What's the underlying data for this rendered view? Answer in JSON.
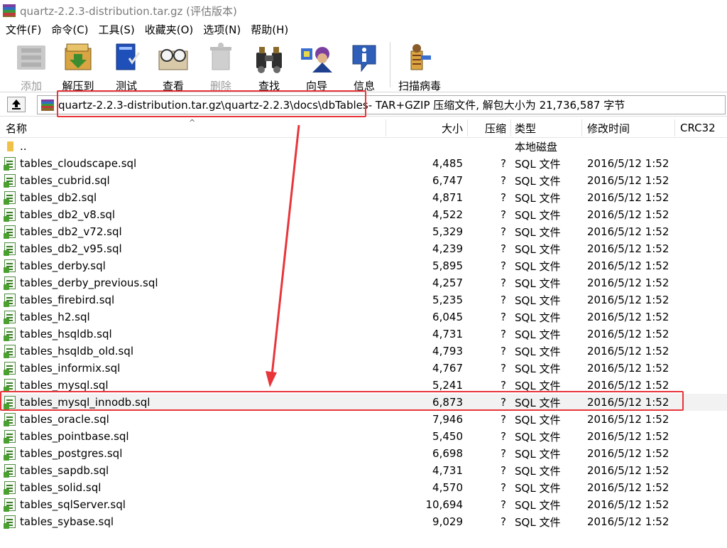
{
  "window": {
    "title": "quartz-2.2.3-distribution.tar.gz (评估版本)"
  },
  "menu": [
    {
      "label": "文件(F)"
    },
    {
      "label": "命令(C)"
    },
    {
      "label": "工具(S)"
    },
    {
      "label": "收藏夹(O)"
    },
    {
      "label": "选项(N)"
    },
    {
      "label": "帮助(H)"
    }
  ],
  "toolbar": {
    "buttons": [
      {
        "label": "添加",
        "icon": "add-icon",
        "enabled": false
      },
      {
        "label": "解压到",
        "icon": "extract-to-icon",
        "enabled": true
      },
      {
        "label": "测试",
        "icon": "test-icon",
        "enabled": true
      },
      {
        "label": "查看",
        "icon": "view-icon",
        "enabled": true
      },
      {
        "label": "删除",
        "icon": "delete-icon",
        "enabled": false
      },
      {
        "label": "查找",
        "icon": "find-icon",
        "enabled": true
      },
      {
        "label": "向导",
        "icon": "wizard-icon",
        "enabled": true
      },
      {
        "label": "信息",
        "icon": "info-icon",
        "enabled": true
      },
      {
        "label": "扫描病毒",
        "icon": "virus-scan-icon",
        "enabled": true
      }
    ]
  },
  "address": {
    "path": "quartz-2.2.3-distribution.tar.gz\\quartz-2.2.3\\docs\\dbTables",
    "suffix": " - TAR+GZIP 压缩文件, 解包大小为 21,736,587 字节"
  },
  "columns": {
    "name": "名称",
    "size": "大小",
    "packed": "压缩",
    "type": "类型",
    "modified": "修改时间",
    "crc": "CRC32"
  },
  "parent_row": {
    "name": "..",
    "type": "本地磁盘"
  },
  "files": [
    {
      "name": "tables_cloudscape.sql",
      "size": "4,485",
      "packed": "?",
      "type": "SQL 文件",
      "modified": "2016/5/12 1:52"
    },
    {
      "name": "tables_cubrid.sql",
      "size": "6,747",
      "packed": "?",
      "type": "SQL 文件",
      "modified": "2016/5/12 1:52"
    },
    {
      "name": "tables_db2.sql",
      "size": "4,871",
      "packed": "?",
      "type": "SQL 文件",
      "modified": "2016/5/12 1:52"
    },
    {
      "name": "tables_db2_v8.sql",
      "size": "4,522",
      "packed": "?",
      "type": "SQL 文件",
      "modified": "2016/5/12 1:52"
    },
    {
      "name": "tables_db2_v72.sql",
      "size": "5,329",
      "packed": "?",
      "type": "SQL 文件",
      "modified": "2016/5/12 1:52"
    },
    {
      "name": "tables_db2_v95.sql",
      "size": "4,239",
      "packed": "?",
      "type": "SQL 文件",
      "modified": "2016/5/12 1:52"
    },
    {
      "name": "tables_derby.sql",
      "size": "5,895",
      "packed": "?",
      "type": "SQL 文件",
      "modified": "2016/5/12 1:52"
    },
    {
      "name": "tables_derby_previous.sql",
      "size": "4,257",
      "packed": "?",
      "type": "SQL 文件",
      "modified": "2016/5/12 1:52"
    },
    {
      "name": "tables_firebird.sql",
      "size": "5,235",
      "packed": "?",
      "type": "SQL 文件",
      "modified": "2016/5/12 1:52"
    },
    {
      "name": "tables_h2.sql",
      "size": "6,045",
      "packed": "?",
      "type": "SQL 文件",
      "modified": "2016/5/12 1:52"
    },
    {
      "name": "tables_hsqldb.sql",
      "size": "4,731",
      "packed": "?",
      "type": "SQL 文件",
      "modified": "2016/5/12 1:52"
    },
    {
      "name": "tables_hsqldb_old.sql",
      "size": "4,793",
      "packed": "?",
      "type": "SQL 文件",
      "modified": "2016/5/12 1:52"
    },
    {
      "name": "tables_informix.sql",
      "size": "4,767",
      "packed": "?",
      "type": "SQL 文件",
      "modified": "2016/5/12 1:52"
    },
    {
      "name": "tables_mysql.sql",
      "size": "5,241",
      "packed": "?",
      "type": "SQL 文件",
      "modified": "2016/5/12 1:52"
    },
    {
      "name": "tables_mysql_innodb.sql",
      "size": "6,873",
      "packed": "?",
      "type": "SQL 文件",
      "modified": "2016/5/12 1:52",
      "selected": true
    },
    {
      "name": "tables_oracle.sql",
      "size": "7,946",
      "packed": "?",
      "type": "SQL 文件",
      "modified": "2016/5/12 1:52"
    },
    {
      "name": "tables_pointbase.sql",
      "size": "5,450",
      "packed": "?",
      "type": "SQL 文件",
      "modified": "2016/5/12 1:52"
    },
    {
      "name": "tables_postgres.sql",
      "size": "6,698",
      "packed": "?",
      "type": "SQL 文件",
      "modified": "2016/5/12 1:52"
    },
    {
      "name": "tables_sapdb.sql",
      "size": "4,731",
      "packed": "?",
      "type": "SQL 文件",
      "modified": "2016/5/12 1:52"
    },
    {
      "name": "tables_solid.sql",
      "size": "4,570",
      "packed": "?",
      "type": "SQL 文件",
      "modified": "2016/5/12 1:52"
    },
    {
      "name": "tables_sqlServer.sql",
      "size": "10,694",
      "packed": "?",
      "type": "SQL 文件",
      "modified": "2016/5/12 1:52"
    },
    {
      "name": "tables_sybase.sql",
      "size": "9,029",
      "packed": "?",
      "type": "SQL 文件",
      "modified": "2016/5/12 1:52"
    }
  ],
  "colors": {
    "highlight": "#e8353a",
    "disabled_text": "#9a9a9a",
    "title_text": "#7a7a7a"
  }
}
